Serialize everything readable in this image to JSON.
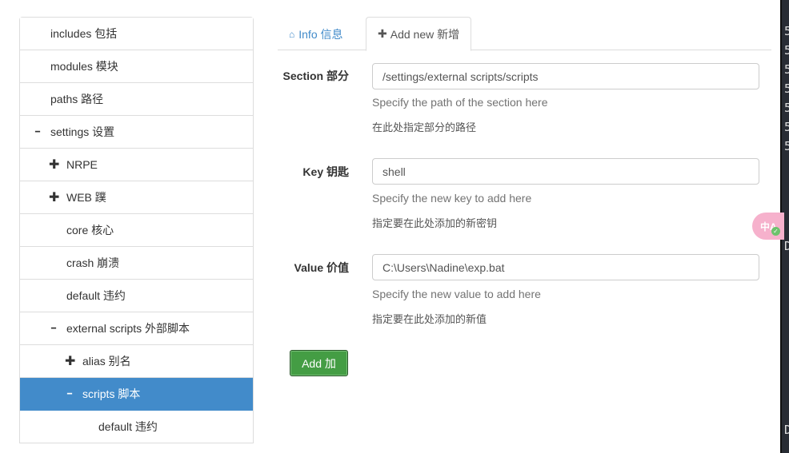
{
  "tree": [
    {
      "label": "includes  包括",
      "level": 0,
      "icon": ""
    },
    {
      "label": "modules  模块",
      "level": 0,
      "icon": ""
    },
    {
      "label": "paths  路径",
      "level": 0,
      "icon": ""
    },
    {
      "label": "settings  设置",
      "level": 0,
      "icon": "minus"
    },
    {
      "label": "NRPE",
      "level": 1,
      "icon": "plus"
    },
    {
      "label": "WEB  蹼",
      "level": 1,
      "icon": "plus"
    },
    {
      "label": "core  核心",
      "level": 1,
      "icon": ""
    },
    {
      "label": "crash  崩溃",
      "level": 1,
      "icon": ""
    },
    {
      "label": "default  违约",
      "level": 1,
      "icon": ""
    },
    {
      "label": "external scripts  外部脚本",
      "level": 1,
      "icon": "minus"
    },
    {
      "label": "alias  别名",
      "level": 2,
      "icon": "plus"
    },
    {
      "label": "scripts  脚本",
      "level": 2,
      "icon": "minus",
      "active": true
    },
    {
      "label": "default  违约",
      "level": 3,
      "icon": ""
    }
  ],
  "tabs": {
    "info": "Info  信息",
    "add": "Add new  新增"
  },
  "form": {
    "section_label": "Section  部分",
    "section_value": "/settings/external scripts/scripts",
    "section_help": "Specify the path of the section here",
    "section_help_cn": "在此处指定部分的路径",
    "key_label": "Key  钥匙",
    "key_value": "shell",
    "key_help": "Specify the new key to add here",
    "key_help_cn": "指定要在此处添加的新密钥",
    "value_label": "Value  价值",
    "value_value": "C:\\Users\\Nadine\\exp.bat",
    "value_help": "Specify the new value to add here",
    "value_help_cn": "指定要在此处添加的新值",
    "add_button": "Add  加"
  },
  "terminal": {
    "lines": [
      "5",
      "5",
      "5",
      "5",
      "5",
      "5",
      "5",
      "D",
      "D"
    ]
  },
  "translate_badge": "中A",
  "colors": {
    "accent": "#428bca",
    "success": "#449d44"
  }
}
